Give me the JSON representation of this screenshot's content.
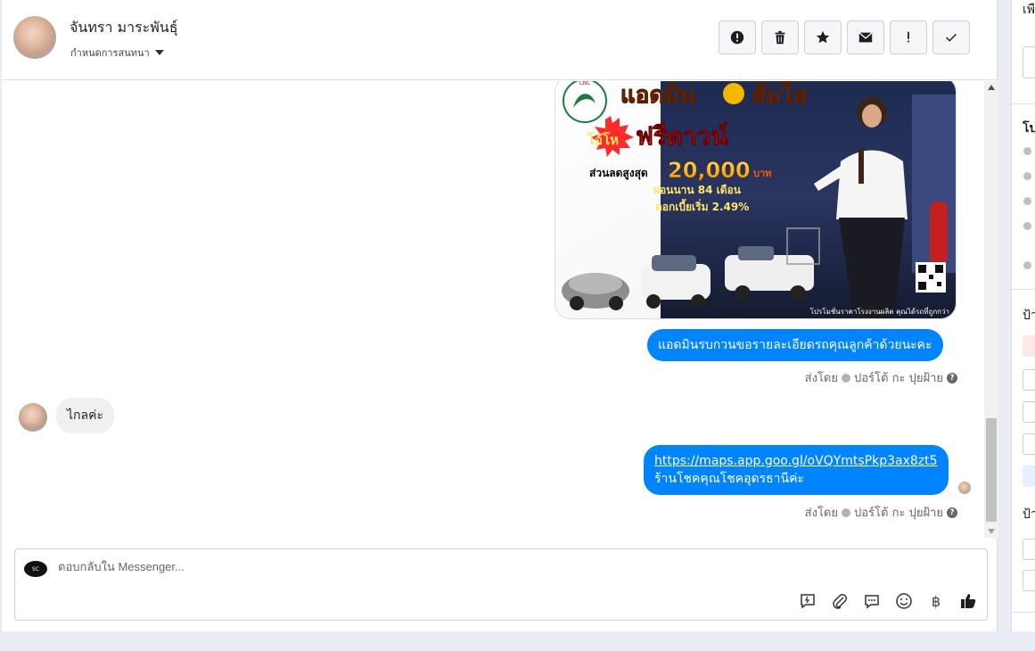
{
  "header": {
    "contact_name": "จันทรา มาระพันธุ์",
    "assign_label": "กำหนดการสนทนา"
  },
  "toolbar": {
    "icons": [
      "alert-circle-icon",
      "trash-icon",
      "star-icon",
      "envelope-icon",
      "exclamation-icon",
      "check-icon"
    ]
  },
  "messages": {
    "image_promo": {
      "brand_line1": "แอดมิน",
      "brand_line2": "ส้มโอ",
      "free_down": "ฟรีดาวน์",
      "prefix": "โอ้โห",
      "discount_label": "ส่วนลดสูงสุด",
      "discount_value": "20,000",
      "discount_unit": "บาท",
      "installment": "ผ่อนนาน 84 เดือน",
      "interest": "ดอกเบี้ยเริ่ม 2.49%",
      "footer": "โปรโมชั่นราคาโรงงานผลิต คุณได้รถที่ถูกกว่า"
    },
    "out_1": "แอดมินรบกวนขอรายละเอียดรถคุณลูกค้าด้วยนะคะ",
    "sent_by_1": "ส่งโดย",
    "sender_1": "ปอร์โต้ กะ ปุยฝ้าย",
    "in_1": "ไกลค่ะ",
    "out_2_link": "https://maps.app.goo.gl/oVQYmtsPkp3ax8zt5",
    "out_2_text": "ร้านโชคคุณโชคอุดรธานีค่ะ",
    "sent_by_2": "ส่งโดย",
    "sender_2": "ปอร์โต้ กะ ปุยฝ้าย"
  },
  "composer": {
    "placeholder": "ตอบกลับใน Messenger...",
    "tools": [
      "quick-reply-icon",
      "paperclip-icon",
      "chat-bubble-icon",
      "emoji-icon",
      "baht-icon",
      "thumbs-up-icon"
    ],
    "baht_symbol": "฿"
  },
  "right_panel": {
    "fragment_1": "เพื",
    "fragment_2": "โป",
    "fragment_3": "ป้า",
    "fragment_4": "ป้า"
  },
  "colors": {
    "accent": "#0084ff",
    "incoming_bubble": "#f0f0f0",
    "border": "#dadde1"
  }
}
